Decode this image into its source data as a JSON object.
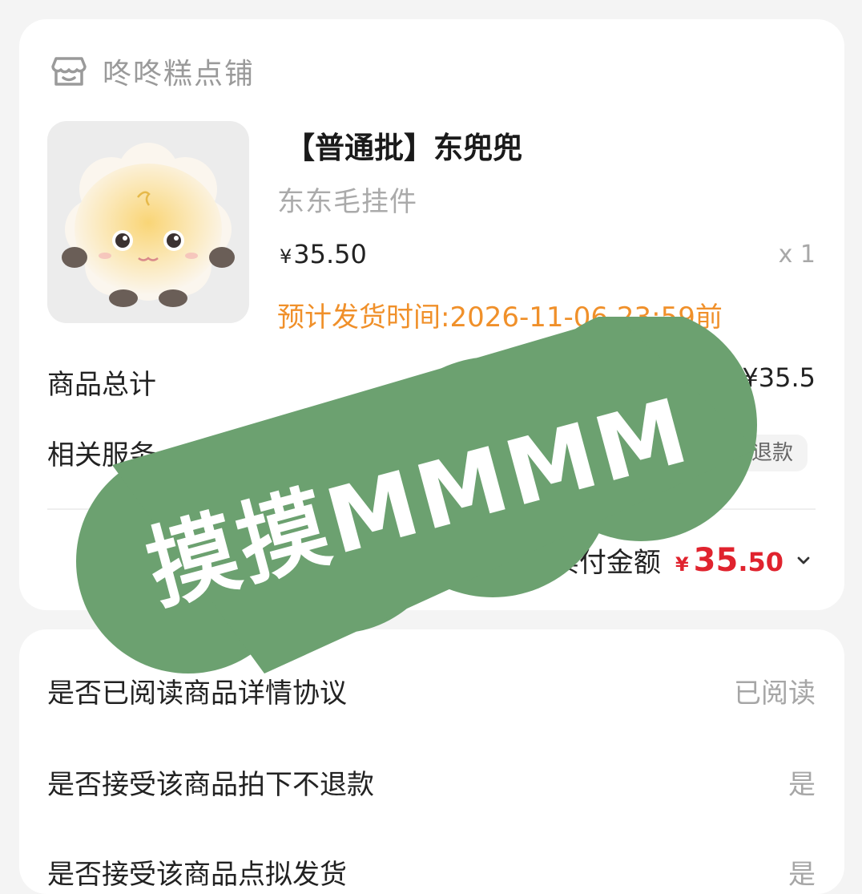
{
  "shop": {
    "name": "咚咚糕点铺",
    "icon": "shop-icon"
  },
  "product": {
    "title": "【普通批】东兜兜",
    "subtitle": "东东毛挂件",
    "price_symbol": "¥",
    "price": "35.50",
    "quantity": "x 1",
    "ship_time": "预计发货时间:2026-11-06 23:59前"
  },
  "summary": {
    "subtotal_label": "商品总计",
    "subtotal_value": "¥35.5",
    "service_label": "相关服务",
    "service_tag": "退款",
    "paid_label": "实付金额",
    "paid_symbol": "¥",
    "paid_int": "35",
    "paid_dec": ".50"
  },
  "agreements": [
    {
      "question": "是否已阅读商品详情协议",
      "answer": "已阅读"
    },
    {
      "question": "是否接受该商品拍下不退款",
      "answer": "是"
    },
    {
      "question": "是否接受该商品点拟发货",
      "answer": "是"
    }
  ],
  "stamp": {
    "text": "摸摸MMMM",
    "color": "#6ca170"
  },
  "colors": {
    "accent_orange": "#f0902a",
    "price_red": "#e0232e"
  }
}
